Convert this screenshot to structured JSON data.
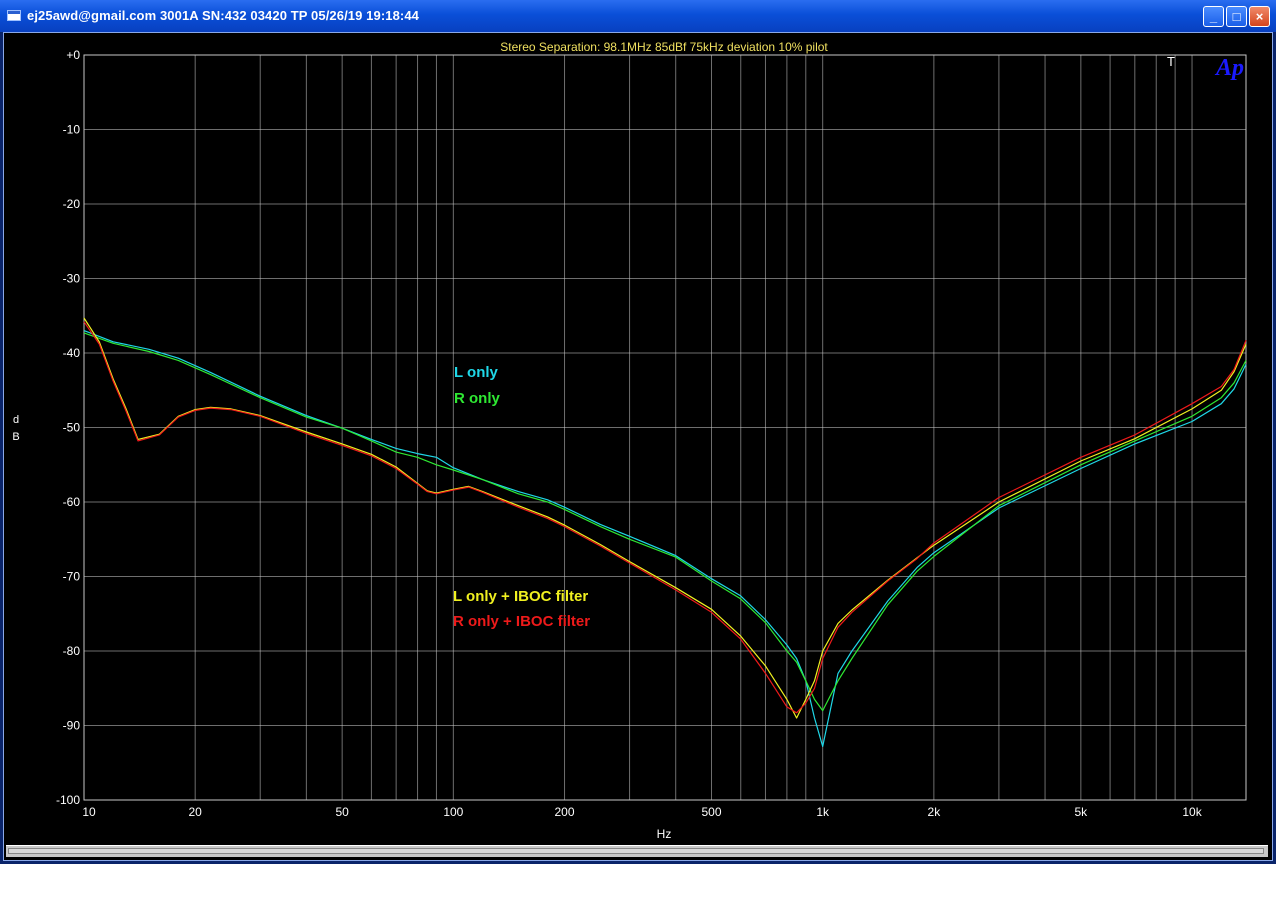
{
  "window": {
    "title": "ej25awd@gmail.com  3001A SN:432 03420 TP  05/26/19 19:18:44",
    "buttons": {
      "minimize": "_",
      "maximize": "□",
      "close": "×"
    }
  },
  "logo_text": "Ap",
  "cursor_marker": "T",
  "chart_data": {
    "type": "line",
    "title": "Stereo Separation: 98.1MHz 85dBf 75kHz deviation 10% pilot",
    "xlabel": "Hz",
    "ylabel_lines": [
      "d",
      "B"
    ],
    "x_scale": "log",
    "xlim": [
      10,
      14000
    ],
    "ylim": [
      -100,
      0
    ],
    "grid": true,
    "x_ticks": [
      {
        "value": 10,
        "label": "10"
      },
      {
        "value": 20,
        "label": "20"
      },
      {
        "value": 50,
        "label": "50"
      },
      {
        "value": 100,
        "label": "100"
      },
      {
        "value": 200,
        "label": "200"
      },
      {
        "value": 500,
        "label": "500"
      },
      {
        "value": 1000,
        "label": "1k"
      },
      {
        "value": 2000,
        "label": "2k"
      },
      {
        "value": 5000,
        "label": "5k"
      },
      {
        "value": 10000,
        "label": "10k"
      }
    ],
    "y_ticks": [
      {
        "value": 0,
        "label": "+0"
      },
      {
        "value": -10,
        "label": "-10"
      },
      {
        "value": -20,
        "label": "-20"
      },
      {
        "value": -30,
        "label": "-30"
      },
      {
        "value": -40,
        "label": "-40"
      },
      {
        "value": -50,
        "label": "-50"
      },
      {
        "value": -60,
        "label": "-60"
      },
      {
        "value": -70,
        "label": "-70"
      },
      {
        "value": -80,
        "label": "-80"
      },
      {
        "value": -90,
        "label": "-90"
      },
      {
        "value": -100,
        "label": "-100"
      }
    ],
    "series": [
      {
        "name": "L only",
        "color": "#1fd8e8",
        "x": [
          10,
          12,
          15,
          18,
          22,
          30,
          40,
          50,
          60,
          70,
          80,
          90,
          100,
          120,
          150,
          180,
          200,
          250,
          300,
          400,
          500,
          600,
          700,
          800,
          850,
          900,
          950,
          1000,
          1100,
          1200,
          1500,
          1800,
          2000,
          3000,
          5000,
          7000,
          10000,
          12000,
          13000,
          14000
        ],
        "y": [
          -37,
          -38.5,
          -39.5,
          -40.7,
          -42.6,
          -45.8,
          -48.4,
          -50.1,
          -51.6,
          -52.8,
          -53.5,
          -54,
          -55.4,
          -57,
          -58.6,
          -59.7,
          -60.7,
          -63,
          -64.6,
          -67.2,
          -70.3,
          -72.6,
          -75.8,
          -79.2,
          -81,
          -84,
          -89,
          -92.8,
          -83,
          -80,
          -73.3,
          -68.8,
          -66.8,
          -60.8,
          -55.5,
          -52.2,
          -49.2,
          -46.8,
          -44.8,
          -41.5
        ]
      },
      {
        "name": "R only",
        "color": "#2ee832",
        "x": [
          10,
          12,
          15,
          18,
          22,
          30,
          40,
          50,
          60,
          70,
          80,
          90,
          100,
          120,
          150,
          180,
          200,
          250,
          300,
          400,
          500,
          600,
          700,
          800,
          850,
          900,
          950,
          1000,
          1100,
          1200,
          1500,
          1800,
          2000,
          3000,
          5000,
          7000,
          10000,
          12000,
          13000,
          14000
        ],
        "y": [
          -37.3,
          -38.7,
          -39.8,
          -41,
          -42.9,
          -46,
          -48.6,
          -50.1,
          -51.8,
          -53.3,
          -54,
          -55,
          -55.7,
          -57,
          -58.9,
          -60,
          -61,
          -63.3,
          -65,
          -67.4,
          -70.6,
          -73,
          -76.2,
          -80,
          -81.5,
          -84,
          -86.5,
          -88,
          -84,
          -81,
          -73.8,
          -69.3,
          -67.3,
          -60.5,
          -55,
          -51.8,
          -48.5,
          -46,
          -44,
          -41
        ]
      },
      {
        "name": "L only + IBOC filter",
        "color": "#f0f020",
        "x": [
          10,
          11,
          12,
          13,
          14,
          16,
          18,
          20,
          22,
          25,
          30,
          40,
          50,
          60,
          70,
          80,
          85,
          90,
          100,
          110,
          120,
          150,
          180,
          200,
          250,
          300,
          400,
          500,
          600,
          700,
          800,
          850,
          900,
          950,
          1000,
          1100,
          1200,
          1500,
          1800,
          2000,
          3000,
          5000,
          7000,
          10000,
          12000,
          13000,
          14000
        ],
        "y": [
          -35.3,
          -38.5,
          -43.5,
          -47.5,
          -51.6,
          -50.9,
          -48.5,
          -47.6,
          -47.3,
          -47.5,
          -48.4,
          -50.6,
          -52.2,
          -53.6,
          -55.3,
          -57.5,
          -58.5,
          -58.8,
          -58.3,
          -57.9,
          -58.6,
          -60.5,
          -62,
          -63.1,
          -65.7,
          -68,
          -71.5,
          -74.4,
          -78,
          -82,
          -86.5,
          -89,
          -86.5,
          -84,
          -80,
          -76.3,
          -74.5,
          -70.5,
          -67.5,
          -65.8,
          -60,
          -54.5,
          -51.5,
          -47.5,
          -45,
          -42.5,
          -38.8
        ]
      },
      {
        "name": "R only + IBOC filter",
        "color": "#ee1a1a",
        "x": [
          10,
          11,
          12,
          13,
          14,
          16,
          18,
          20,
          22,
          25,
          30,
          40,
          50,
          60,
          70,
          80,
          85,
          90,
          100,
          110,
          120,
          150,
          180,
          200,
          250,
          300,
          400,
          500,
          600,
          700,
          800,
          850,
          900,
          950,
          1000,
          1100,
          1200,
          1500,
          1800,
          2000,
          3000,
          5000,
          7000,
          10000,
          12000,
          13000,
          14000
        ],
        "y": [
          -35.8,
          -38.8,
          -43.8,
          -47.8,
          -51.8,
          -51,
          -48.6,
          -47.7,
          -47.4,
          -47.6,
          -48.5,
          -50.8,
          -52.4,
          -53.8,
          -55.5,
          -57.6,
          -58.6,
          -58.9,
          -58.4,
          -58,
          -58.7,
          -60.7,
          -62.2,
          -63.3,
          -65.9,
          -68.2,
          -71.8,
          -74.8,
          -78.4,
          -83,
          -87.5,
          -88.3,
          -87,
          -85,
          -81,
          -76.8,
          -74.8,
          -70.6,
          -67.6,
          -65.5,
          -59.4,
          -54,
          -51,
          -46.8,
          -44.5,
          -42.2,
          -38.3
        ]
      }
    ],
    "legend": [
      {
        "label": "L only",
        "color": "#1fd8e8"
      },
      {
        "label": "R only",
        "color": "#2ee832"
      },
      {
        "label": "L only + IBOC filter",
        "color": "#f0f020"
      },
      {
        "label": "R only + IBOC filter",
        "color": "#ee1a1a"
      }
    ],
    "colors": {
      "background": "#000000",
      "grid": "#c8c8c8",
      "axis_text": "#ffffff",
      "title_text": "#f0e060",
      "logo": "#1a1aff"
    }
  }
}
